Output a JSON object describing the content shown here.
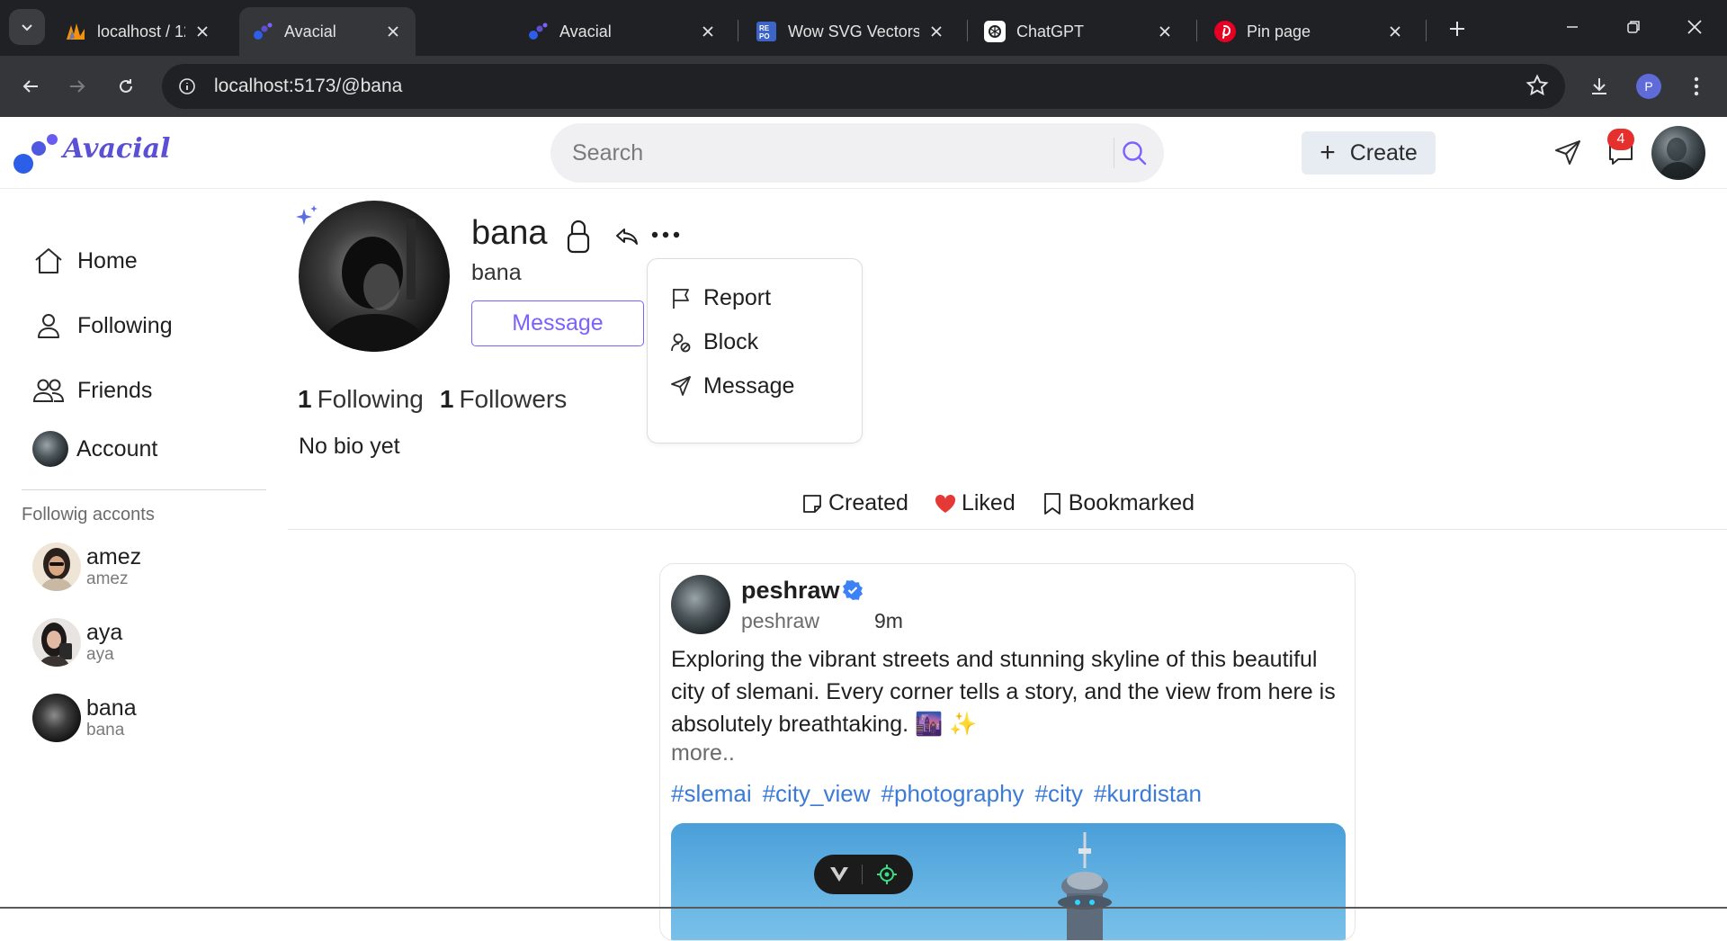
{
  "browser": {
    "tabs": [
      {
        "title": "localhost / 127.0.0.1",
        "icon": "phpmyadmin-icon",
        "active": false
      },
      {
        "title": "Avacial",
        "icon": "avacial-icon",
        "active": true
      },
      {
        "title": "Avacial",
        "icon": "avacial-icon",
        "active": false
      },
      {
        "title": "Wow SVG Vectors",
        "icon": "svgrepo-icon",
        "active": false
      },
      {
        "title": "ChatGPT",
        "icon": "chatgpt-icon",
        "active": false
      },
      {
        "title": "Pin page",
        "icon": "pinterest-icon",
        "active": false
      }
    ],
    "url": "localhost:5173/@bana",
    "profile_initial": "P"
  },
  "app": {
    "logo_text": "Avacial",
    "search_placeholder": "Search",
    "create_label": "Create",
    "notification_count": "4",
    "accent_color": "#7b61ff"
  },
  "sidebar": {
    "items": [
      {
        "label": "Home",
        "icon": "home-icon"
      },
      {
        "label": "Following",
        "icon": "user-icon"
      },
      {
        "label": "Friends",
        "icon": "users-icon"
      },
      {
        "label": "Account",
        "icon": "avatar"
      }
    ],
    "section_title": "Followig acconts",
    "following": [
      {
        "name": "amez",
        "username": "amez"
      },
      {
        "name": "aya",
        "username": "aya"
      },
      {
        "name": "bana",
        "username": "bana"
      }
    ]
  },
  "profile": {
    "name": "bana",
    "username": "bana",
    "message_label": "Message",
    "following_count": "1",
    "following_label": "Following",
    "followers_count": "1",
    "followers_label": "Followers",
    "bio": "No bio yet"
  },
  "menu": {
    "items": [
      {
        "label": "Report",
        "icon": "flag-icon"
      },
      {
        "label": "Block",
        "icon": "block-user-icon"
      },
      {
        "label": "Message",
        "icon": "send-icon"
      }
    ]
  },
  "profile_tabs": [
    {
      "label": "Created",
      "icon": "note-icon"
    },
    {
      "label": "Liked",
      "icon": "heart-icon"
    },
    {
      "label": "Bookmarked",
      "icon": "bookmark-icon"
    }
  ],
  "post": {
    "author_name": "peshraw",
    "author_username": "peshraw",
    "time": "9m",
    "text": "Exploring the vibrant streets and stunning skyline of this beautiful city of slemani. Every corner tells a story, and the view from here is absolutely breathtaking. 🌆 ✨",
    "more_label": "more..",
    "tags": [
      "#slemai",
      "#city_view",
      "#photography",
      "#city",
      "#kurdistan"
    ]
  }
}
